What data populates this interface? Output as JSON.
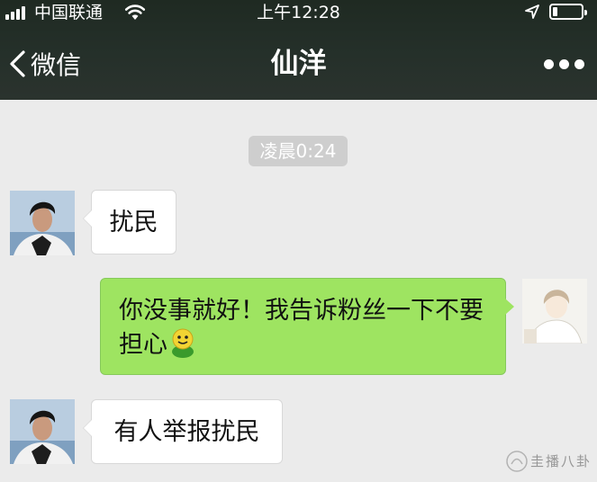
{
  "status_bar": {
    "carrier": "中国联通",
    "time": "上午12:28",
    "signal_icon": "signal-bars-icon",
    "wifi_icon": "wifi-icon",
    "location_icon": "location-arrow-icon",
    "battery_icon": "battery-icon",
    "battery_level": 0.15
  },
  "nav": {
    "back_label": "微信",
    "title": "仙洋",
    "more_icon": "more-dots-icon"
  },
  "chat": {
    "timestamp": "凌晨0:24",
    "messages": [
      {
        "side": "left",
        "sender": "仙洋",
        "text": "扰民"
      },
      {
        "side": "right",
        "sender": "me",
        "text": "你没事就好！我告诉粉丝一下不要担心",
        "emoji": "smiley-emoji"
      },
      {
        "side": "left",
        "sender": "仙洋",
        "text": "有人举报扰民"
      }
    ]
  },
  "colors": {
    "header_bg": "#25302a",
    "chat_bg": "#ebebeb",
    "sent_bubble": "#9ee461",
    "received_bubble": "#ffffff",
    "timestamp_bg": "#cecece"
  },
  "watermark": {
    "text": "圭播八卦"
  }
}
